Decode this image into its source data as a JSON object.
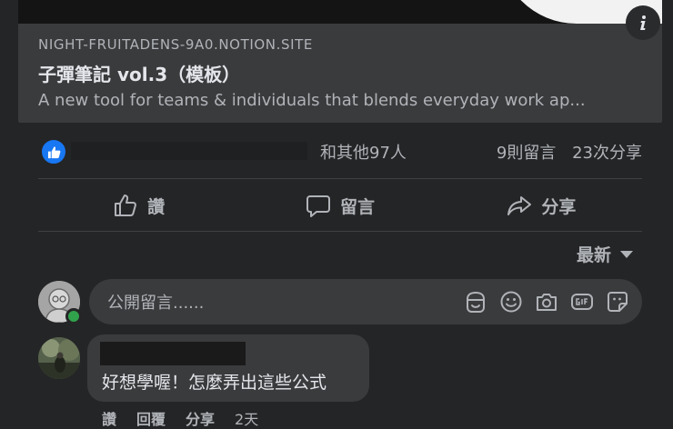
{
  "link_card": {
    "domain": "NIGHT-FRUITADENS-9A0.NOTION.SITE",
    "title": "子彈筆記 vol.3（模板）",
    "description": "A new tool for teams & individuals that blends everyday work ap..."
  },
  "summary": {
    "others": "和其他97人",
    "comments": "9則留言",
    "shares": "23次分享"
  },
  "actions": {
    "like": "讚",
    "comment": "留言",
    "share": "分享"
  },
  "sort": {
    "label": "最新"
  },
  "composer": {
    "placeholder": "公開留言......"
  },
  "comment": {
    "text": "好想學喔！怎麼弄出這些公式",
    "like": "讚",
    "reply": "回覆",
    "share": "分享",
    "time": "2天"
  },
  "colors": {
    "background": "#242526",
    "surface": "#3a3b3c",
    "accent": "#1877f2",
    "online": "#31a24c",
    "secondary_text": "#b0b3b8"
  }
}
